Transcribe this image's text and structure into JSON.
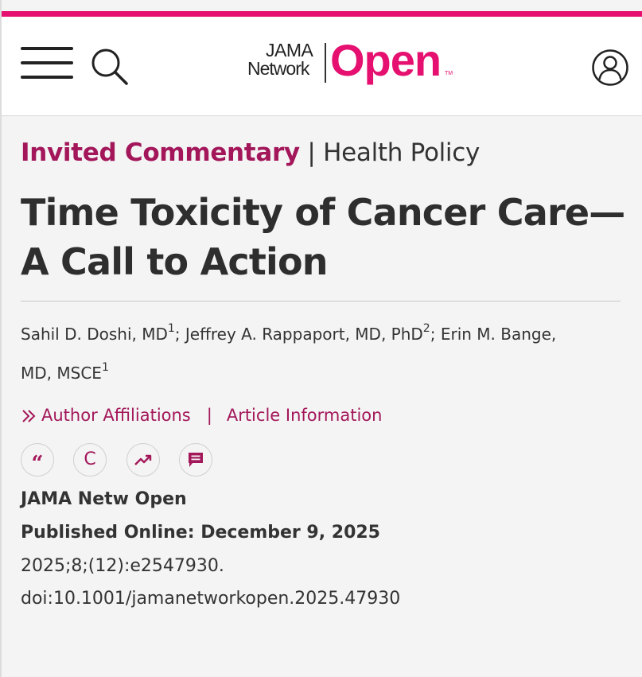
{
  "logo": {
    "line1": "JAMA",
    "line2": "Network",
    "brand": "Open",
    "trademark": "TM"
  },
  "icons": {
    "menu": "hamburger-menu-icon",
    "search": "search-icon",
    "user": "user-account-icon",
    "cite": "quote-icon",
    "permissions": "copyright-icon",
    "metrics": "trending-icon",
    "comment": "comment-icon",
    "chevron": "double-chevron-right-icon"
  },
  "colors": {
    "brand_pink": "#e5106f",
    "accent_maroon": "#a3175a",
    "text": "#333333",
    "background": "#f4f4f4"
  },
  "article": {
    "category_type": "Invited Commentary",
    "category_separator": " | ",
    "category_topic": "Health Policy",
    "title": "Time Toxicity of Cancer Care—A Call to Action",
    "authors": [
      {
        "name": "Sahil D. Doshi, MD",
        "affiliation": "1"
      },
      {
        "name": "Jeffrey A. Rappaport, MD, PhD",
        "affiliation": "2"
      },
      {
        "name": "Erin M. Bange, MD, MSCE",
        "affiliation": "1"
      }
    ],
    "author_separator": "; ",
    "links": {
      "affiliations": "Author Affiliations",
      "separator": "|",
      "information": "Article Information"
    },
    "actions": {
      "cite_glyph": "“",
      "permissions_glyph": "C"
    },
    "journal": "JAMA Netw Open",
    "published": "Published Online: December 9, 2025",
    "citation": "2025;8;(12):e2547930.",
    "doi": "doi:10.1001/jamanetworkopen.2025.47930"
  }
}
